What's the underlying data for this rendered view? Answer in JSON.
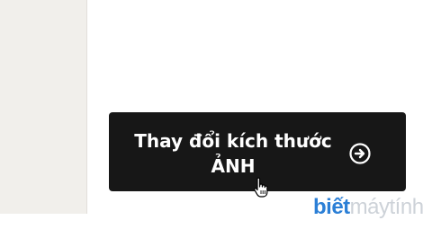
{
  "button": {
    "line1": "Thay đổi kích thước",
    "line2": "ẢNH",
    "icon": "arrow-right-circle-icon"
  },
  "watermark": {
    "part1": "biết",
    "part2": "máytính"
  },
  "colors": {
    "button_bg": "#171717",
    "button_text": "#ffffff",
    "panel_bg": "#f1efeb",
    "watermark_blue": "#2b7fd6"
  }
}
